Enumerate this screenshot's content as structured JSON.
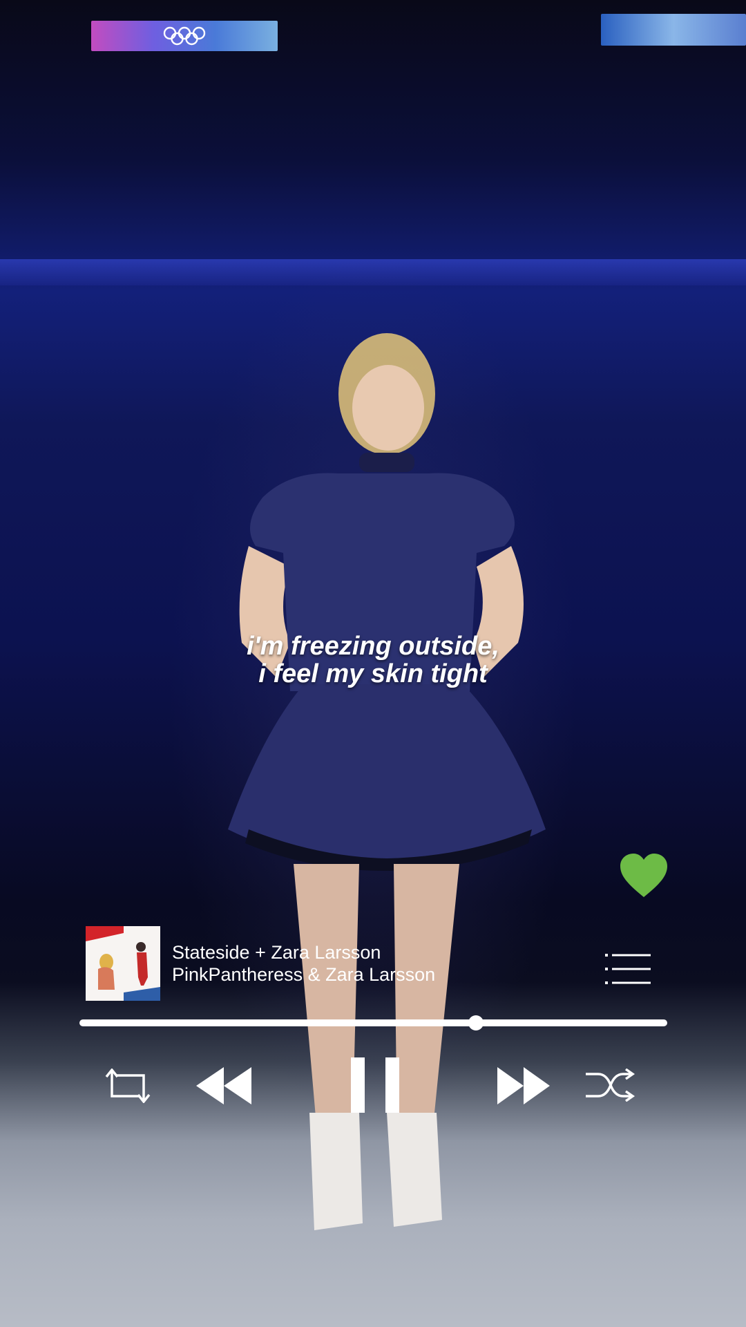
{
  "lyrics": {
    "line1": "i'm freezing outside,",
    "line2": "i feel my skin tight"
  },
  "now_playing": {
    "title": "Stateside + Zara Larsson",
    "artist": "PinkPantheress & Zara Larsson",
    "progress": 0.675,
    "liked": true
  },
  "colors": {
    "like_green": "#6dbb46",
    "controls": "#ffffff"
  },
  "icons": {
    "like": "heart-icon",
    "queue": "queue-list-icon",
    "repeat": "repeat-icon",
    "previous": "rewind-icon",
    "pause": "pause-icon",
    "next": "fast-forward-icon",
    "shuffle": "shuffle-icon"
  }
}
